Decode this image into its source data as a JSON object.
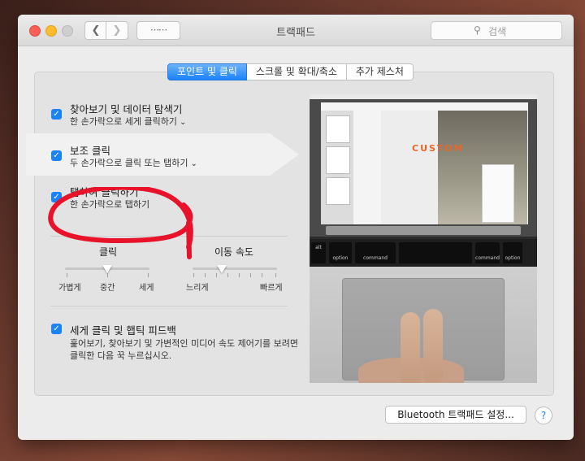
{
  "window": {
    "title": "트랙패드"
  },
  "search": {
    "placeholder": "검색"
  },
  "tabs": [
    {
      "label": "포인트 및 클릭",
      "active": true
    },
    {
      "label": "스크롤 및 확대/축소",
      "active": false
    },
    {
      "label": "추가 제스처",
      "active": false
    }
  ],
  "options": [
    {
      "title": "찾아보기 및 데이터 탐색기",
      "subtitle": "한 손가락으로 세게 클릭하기",
      "checked": true,
      "has_menu": true
    },
    {
      "title": "보조 클릭",
      "subtitle": "두 손가락으로 클릭 또는 탭하기",
      "checked": true,
      "has_menu": true
    },
    {
      "title": "탭하여 클릭하기",
      "subtitle": "한 손가락으로 탭하기",
      "checked": true,
      "has_menu": false
    }
  ],
  "click_slider": {
    "label": "클릭",
    "ticks": [
      "가볍게",
      "중간",
      "세게"
    ],
    "value": "중간"
  },
  "speed_slider": {
    "label": "이동 속도",
    "ticks": [
      "느리게",
      "빠르게"
    ],
    "value_fraction": 0.35
  },
  "force_click": {
    "title": "세게 클릭 및 햅틱 피드백",
    "checked": true,
    "desc1": "훑어보기, 찾아보기 및 가변적인 미디어 속도 제어기를 보려면",
    "desc2": "클릭한 다음 꾹 누르십시오."
  },
  "preview": {
    "custom_text": "CUSTOM",
    "keys": {
      "alt": "alt",
      "option": "option",
      "command": "command"
    }
  },
  "bluetooth_button": "Bluetooth 트랙패드 설정...",
  "help_label": "?",
  "colors": {
    "accent": "#1a82fb",
    "annotation": "#e8132b"
  }
}
